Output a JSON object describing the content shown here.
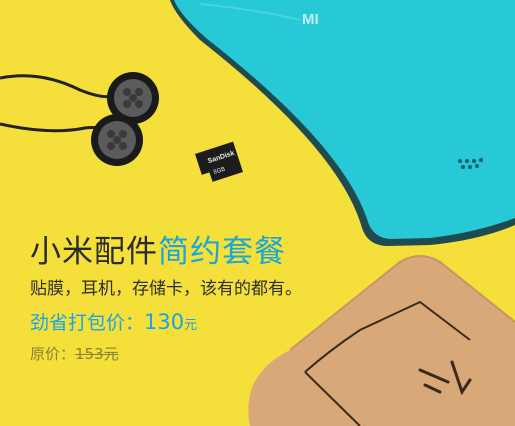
{
  "banner": {
    "colors": {
      "background": "#f4df3b",
      "accent": "#1aa6d6",
      "phone": "#27c9d6",
      "box": "#d9a878"
    },
    "phone": {
      "brand_logo": "MI"
    },
    "sdcard": {
      "brand": "SanDisk",
      "capacity": "8GB"
    },
    "icons": [
      "earphones-icon",
      "phone-back-cover-icon",
      "micro-sd-card-icon",
      "package-box-icon"
    ],
    "headline": {
      "part1": "小米配件",
      "part2": "简约套餐"
    },
    "subtitle": "贴膜，耳机，存储卡，该有的都有。",
    "price": {
      "label": "劲省打包价：",
      "value": "130",
      "unit": "元"
    },
    "original": {
      "label": "原价：",
      "value": "153",
      "unit": "元"
    }
  }
}
